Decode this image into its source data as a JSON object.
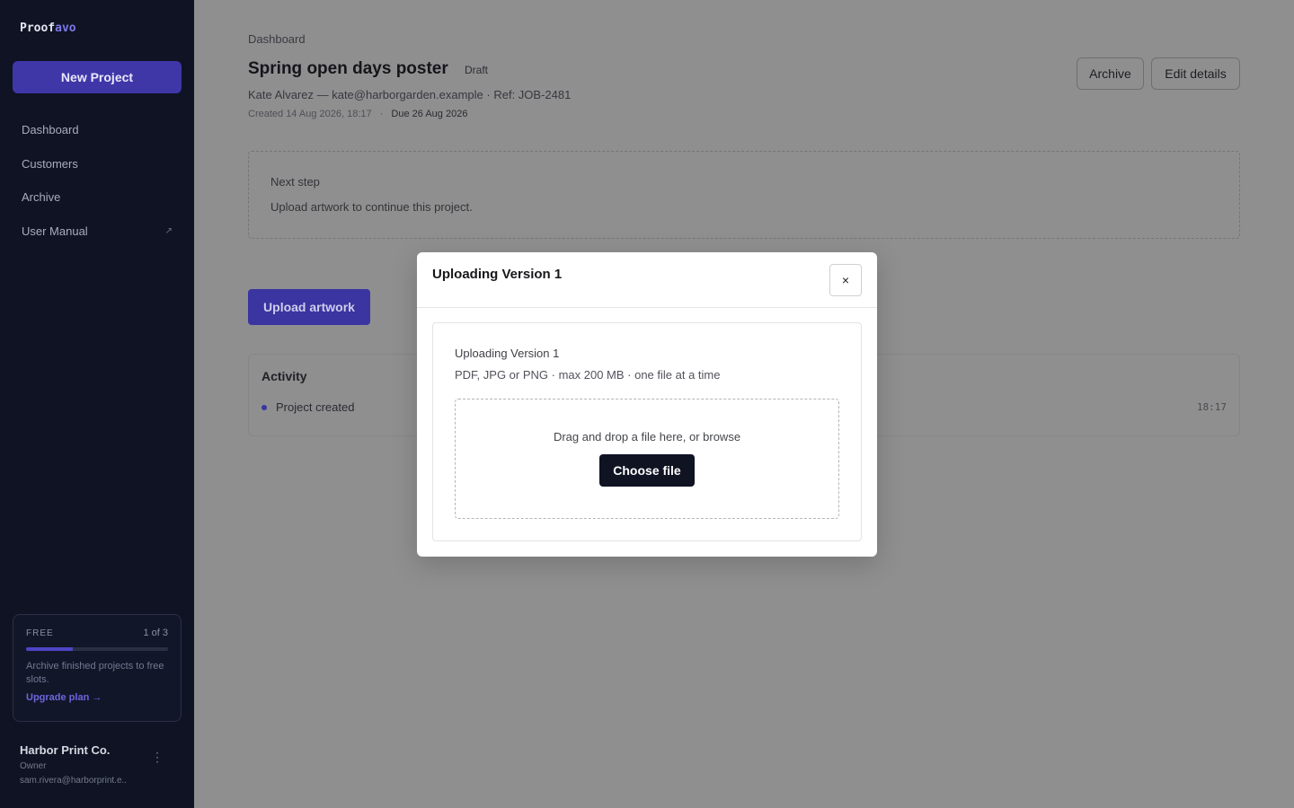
{
  "app": {
    "logo_part1": "Proof",
    "logo_part2": "avo",
    "new_project_label": "New Project"
  },
  "sidebar": {
    "items": [
      {
        "label": "Dashboard"
      },
      {
        "label": "Customers"
      },
      {
        "label": "Archive"
      },
      {
        "label": "User Manual",
        "icon": "external-link-icon",
        "icon_glyph": "↗"
      }
    ],
    "plan": {
      "tier": "FREE",
      "usage": "1 of 3",
      "usage_fraction": 0.33,
      "message": "Archive finished projects to free slots.",
      "upgrade_link": "Upgrade plan →"
    },
    "account": {
      "name": "Harbor Print Co.",
      "role": "Owner",
      "email": "sam.rivera@harborprint.e..",
      "menu_glyph": "⋮"
    }
  },
  "header": {
    "breadcrumb": "Dashboard",
    "title": "Spring open days poster",
    "status": "Draft",
    "meta": "Kate Alvarez — kate@harborgarden.example · Ref: JOB-2481",
    "created": "Created 14 Aug 2026, 18:17",
    "separator": "·",
    "due": "Due 26 Aug 2026",
    "archive_label": "Archive",
    "edit_label": "Edit details"
  },
  "next_step": {
    "label": "Next step",
    "text": "Upload artwork to continue this project."
  },
  "upload_artwork_label": "Upload artwork",
  "activity": {
    "title": "Activity",
    "items": [
      {
        "text": "Project created",
        "time": "18:17"
      }
    ]
  },
  "modal": {
    "title": "Uploading Version 1",
    "close_glyph": "×",
    "card_title": "Uploading Version 1",
    "hint": "PDF, JPG or PNG · max 200 MB · one file at a time",
    "dropzone_text": "Drag and drop a file here, or browse",
    "choose_label": "Choose file"
  },
  "colors": {
    "sidebar_bg": "#0f1324",
    "accent": "#3f37a8",
    "overlay": "#8f8f90"
  }
}
